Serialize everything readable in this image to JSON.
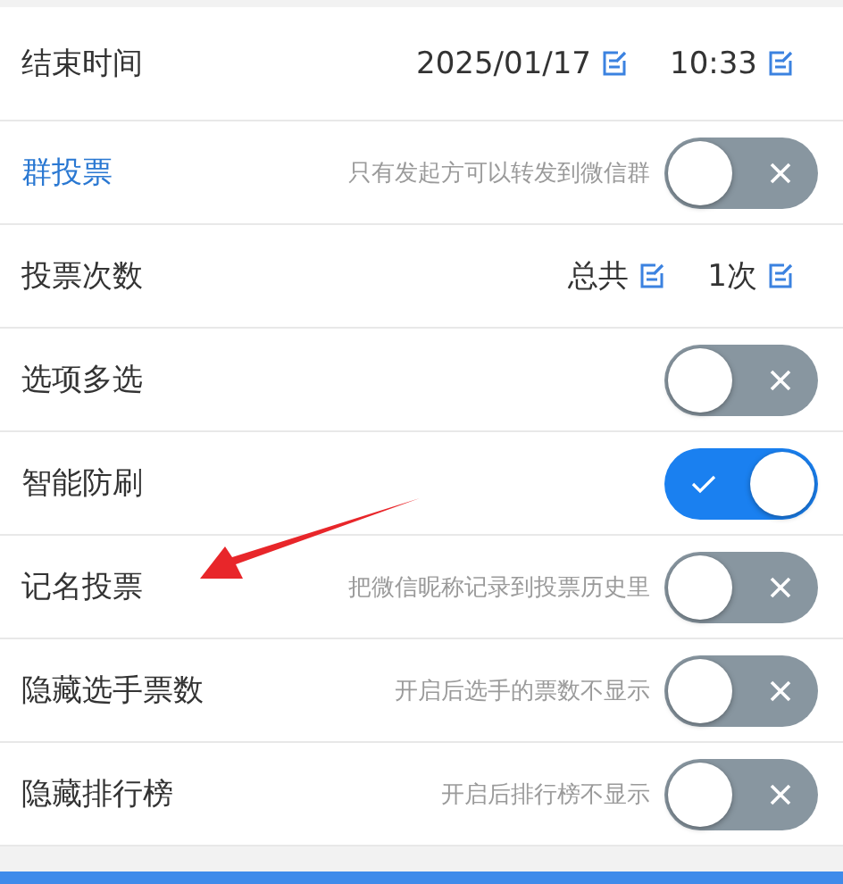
{
  "rows": [
    {
      "kind": "values",
      "label": "结束时间",
      "link": false,
      "values": [
        "2025/01/17",
        "10:33"
      ]
    },
    {
      "kind": "toggle",
      "label": "群投票",
      "link": true,
      "hint": "只有发起方可以转发到微信群",
      "on": false
    },
    {
      "kind": "values",
      "label": "投票次数",
      "link": false,
      "values": [
        "总共",
        "1次"
      ]
    },
    {
      "kind": "toggle",
      "label": "选项多选",
      "link": false,
      "on": false
    },
    {
      "kind": "toggle",
      "label": "智能防刷",
      "link": false,
      "on": true
    },
    {
      "kind": "toggle",
      "label": "记名投票",
      "link": false,
      "hint": "把微信昵称记录到投票历史里",
      "on": false
    },
    {
      "kind": "toggle",
      "label": "隐藏选手票数",
      "link": false,
      "hint": "开启后选手的票数不显示",
      "on": false
    },
    {
      "kind": "toggle",
      "label": "隐藏排行榜",
      "link": false,
      "hint": "开启后排行榜不显示",
      "on": false
    }
  ]
}
